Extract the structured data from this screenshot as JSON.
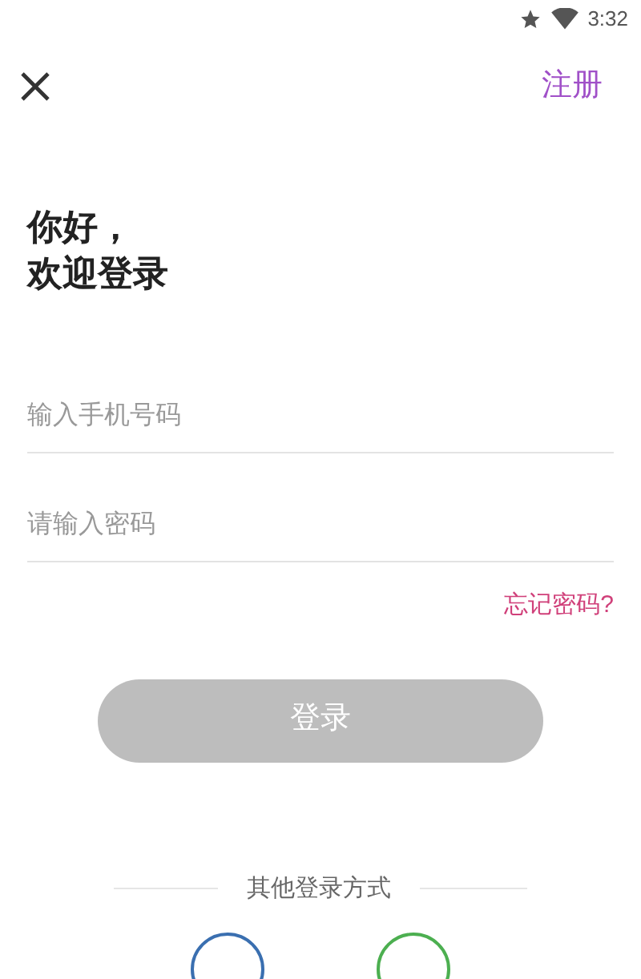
{
  "status_bar": {
    "time": "3:32"
  },
  "top_bar": {
    "register_link": "注册"
  },
  "greeting": [
    "你好，",
    "欢迎登录"
  ],
  "fields": [
    {
      "placeholder": "输入手机号码"
    },
    {
      "placeholder": "请输入密码"
    }
  ],
  "forgot_password": "忘记密码?",
  "login_button": {
    "label": "登录",
    "disabled": true
  },
  "other_login": {
    "label": "其他登录方式",
    "options": [
      {
        "color": "#3a6fb0"
      },
      {
        "color": "#4caf50"
      }
    ]
  }
}
